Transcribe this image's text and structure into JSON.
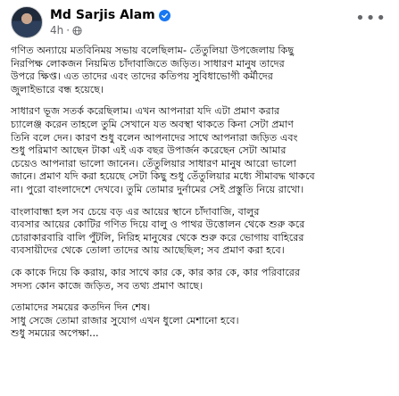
{
  "post": {
    "author": "Md Sarjis Alam",
    "timestamp": "4h",
    "paragraphs": [
      [
        "গণিত অন্যায়ে মতবিনিময় সভায় বলেছিলাম- তেঁতুলিয়া উপজেলায় কিছু",
        "নিরপিক্ষ লোকজন নিয়মিত চাঁদাবাজিতে জড়িত। সাধারণ মানুষ তাদের",
        "উপরে ক্ষিপ্ত। এত তাদের এবং তাদের কতিপয় সুবিধাভোগী কর্মীদের",
        "জুলাইভারে বন্ধ হয়েছে।"
      ],
      [
        "সাধারণ ভূজ সতর্ক করেছিলাম। এখন আপনারা যদি এটা প্রমাণ করার",
        "চ্যালেঞ্জ করেন তাহলে তুমি সেখানে যত অবস্থা থাকতে কিনা সেটা প্রমাণ",
        "তিনি বলে দেন। কারণ শুধু বলেন আপনাদের সাথে আপনারা জড়িত এবং",
        "শুধু পরিমাণ আছেন টাকা এই এক বছর উপার্জন করেছেন সেটা আমার",
        "চেয়েও আপনারা ভালো জানেন। তেঁতুলিয়ার সাধারণ মানুষ আরো ভালো",
        "জানে। প্রমাণ যদি করা হয়েছে সেটা কিছু শুধু তেঁতুলিয়ার মধ্যে সীমাবদ্ধ থাকবে",
        "না। পুরো বাংলাদেশে দেখবে। তুমি তোমার দুর্নামের সেই প্রস্তুতি নিয়ে রাখো।"
      ],
      [
        "বাংলাবান্ধা হল সব চেয়ে বড় এর আয়ের স্থানে চাঁদাবাজি, বালুর",
        "ব্যবসার আয়ের কোটির গণিত দিয়ে বালু ও পাথর উত্তোলন থেকে শুরু করে",
        "চোরাকারবারি বালি পুঁটলি, নিরিহ মানুষের থেকে শুরু করে ভোগায় বাহিরের",
        "ব্যবসায়ীদের থেকে তোলা তাদের আয় আছেছিল; সব প্রমাণ করা হবে।"
      ],
      [
        "কে কাকে দিয়ে কি করায়, কার সাথে কার কে, কার কার কে, কার পরিবারের",
        "সদস্য কোন কাজে জড়িত, সব তথ্য প্রমাণ আছে।"
      ],
      [
        "তোমাদের সময়ের কতদিন দিন শেষ।",
        "সাধু সেজে তোমা রাজার সুযোগ এখন ধুলো মেশানো হবে।",
        "শুধু সময়ের অপেক্ষা..."
      ]
    ]
  },
  "colors": {
    "verified_badge": "#1877f2",
    "secondary_text": "#65676b",
    "primary_text": "#050505"
  },
  "icons": [
    "verified-badge-icon",
    "globe-icon",
    "more-options-icon"
  ]
}
